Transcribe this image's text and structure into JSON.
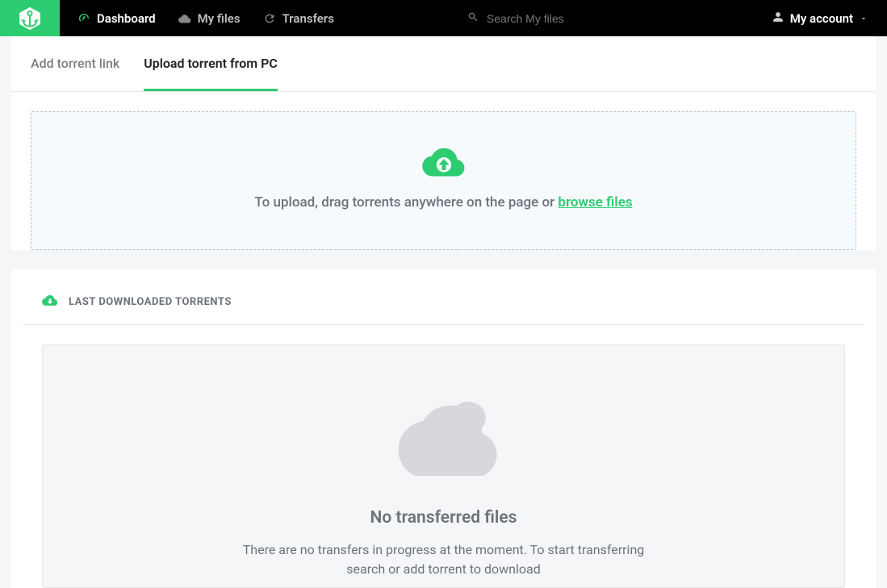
{
  "header": {
    "nav": {
      "dashboard": "Dashboard",
      "myfiles": "My files",
      "transfers": "Transfers"
    },
    "search_placeholder": "Search My files",
    "account_label": "My account"
  },
  "tabs": {
    "add_link": "Add torrent link",
    "upload_pc": "Upload torrent from PC"
  },
  "upload": {
    "prefix": "To upload, drag torrents anywhere on the page or ",
    "browse": "browse files"
  },
  "section": {
    "last_downloaded": "LAST DOWNLOADED TORRENTS"
  },
  "empty": {
    "title": "No transferred files",
    "subtitle": "There are no transfers in progress at the moment. To start transferring search or add torrent to download"
  },
  "colors": {
    "accent": "#2ecc71"
  }
}
